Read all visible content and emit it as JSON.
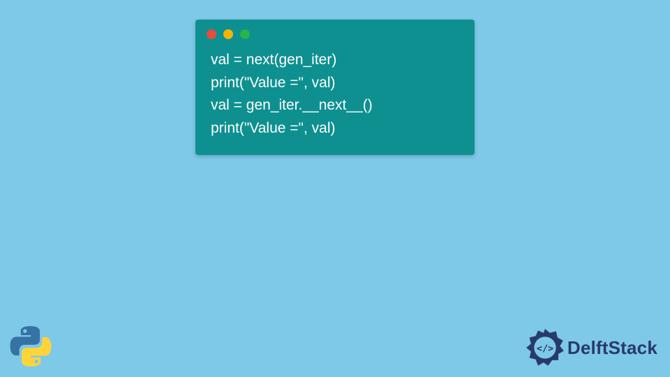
{
  "code": {
    "lines": [
      "val = next(gen_iter)",
      "print(\"Value =\", val)",
      "",
      "val = gen_iter.__next__()",
      "print(\"Value =\", val)"
    ]
  },
  "brand": {
    "name": "DelftStack"
  }
}
